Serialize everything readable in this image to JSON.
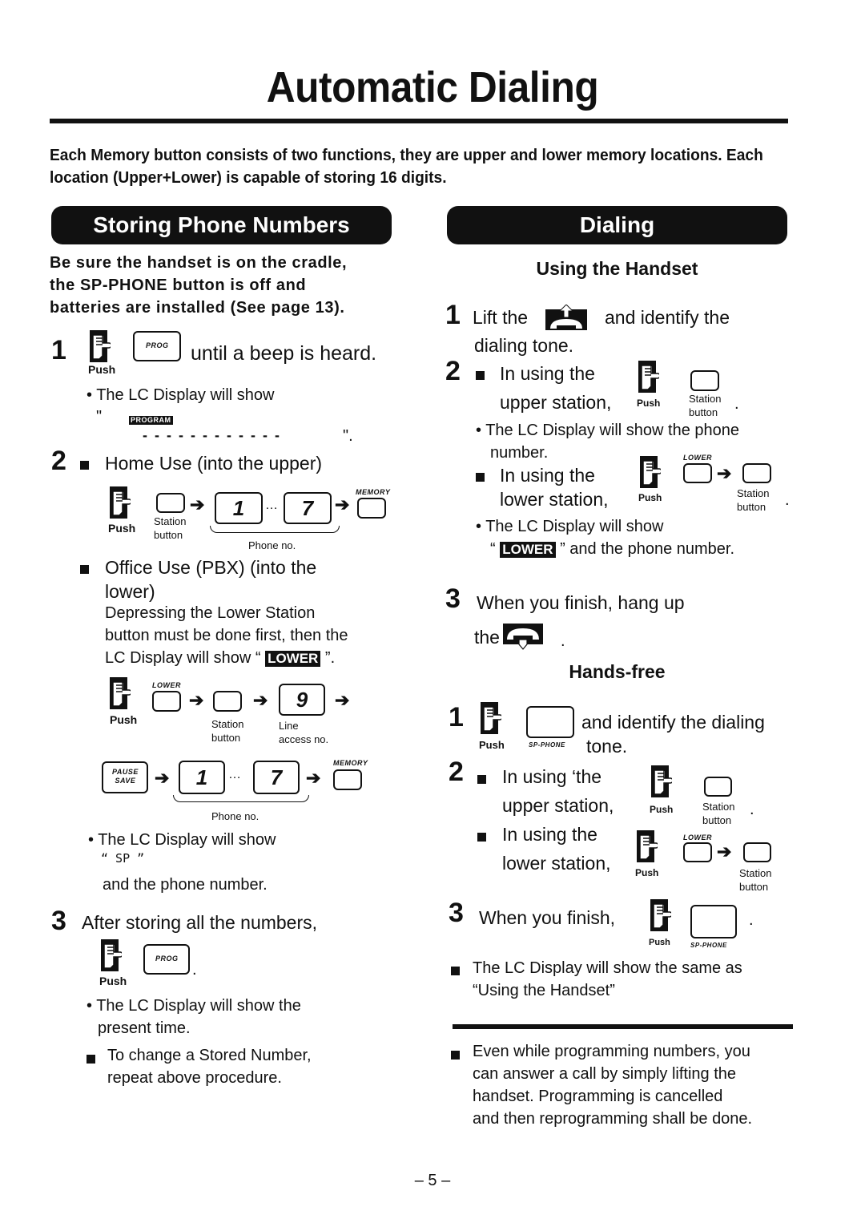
{
  "page": {
    "title": "Automatic Dialing",
    "intro": "Each Memory button consists of two functions, they are upper and lower memory locations. Each location (Upper+Lower) is capable of storing 16 digits.",
    "page_number": "– 5 –"
  },
  "icons": {
    "push_hand": "push-hand-icon",
    "handset_lift": "handset-lift-icon",
    "handset_hangup": "handset-hangup-icon",
    "arrow": "arrow-right-icon",
    "bullet_square": "square-bullet-icon"
  },
  "labels": {
    "push": "Push",
    "station": "Station",
    "button": "button",
    "phone_no": "Phone no.",
    "line": "Line",
    "access_no": "access no.",
    "memory": "MEMORY",
    "lower": "LOWER",
    "prog": "PROG",
    "pause": "PAUSE",
    "save": "SAVE",
    "sp_phone": "SP-PHONE",
    "key_1": "1",
    "key_7": "7",
    "key_9": "9",
    "ellipsis": "…",
    "arrow": "➔",
    "dot": "."
  },
  "storing": {
    "banner": "Storing Phone Numbers",
    "precondition": [
      "Be sure the handset is on the cradle,",
      "the SP-PHONE button is off and",
      "batteries are installed (See page 13)."
    ],
    "step1": {
      "num": "1",
      "text": "until a beep is heard.",
      "bullet": "• The LC Display will show",
      "display_open": "\"",
      "display_badge": "PROGRAM",
      "display_dashes": "- - - - - - - - - - - -",
      "display_close": "\"."
    },
    "step2": {
      "num": "2",
      "home_use": "Home Use (into the upper)",
      "office_use_1": "Office Use (PBX) (into the",
      "office_use_2": "lower)",
      "note": [
        "Depressing the Lower Station",
        "button must be done first, then the"
      ],
      "note_last_pre": "LC Display will show “",
      "note_badge": "LOWER",
      "note_last_post": "”.",
      "bullet": "• The LC Display will show",
      "sp_display": "“ SP ”",
      "after": "and the phone number."
    },
    "step3": {
      "num": "3",
      "text": "After storing all the numbers,",
      "bullet_1": "• The LC Display will show the",
      "bullet_2": "present time.",
      "note_1": "To change a Stored Number,",
      "note_2": "repeat above procedure."
    }
  },
  "dialing": {
    "banner": "Dialing",
    "handset": {
      "heading": "Using the Handset",
      "step1_num": "1",
      "step1_pre": "Lift the",
      "step1_post": "and identify the",
      "step1_line2": "dialing tone.",
      "step2_num": "2",
      "upper_1": "In using the",
      "upper_2": "upper station,",
      "upper_bullet_1": "• The LC Display will show the phone",
      "upper_bullet_2": "number.",
      "lower_1": "In using the",
      "lower_2": "lower station,",
      "lower_bullet_1": "• The LC Display will show",
      "lower_bullet_2_pre": "“",
      "lower_badge": "LOWER",
      "lower_bullet_2_post": "” and the phone number.",
      "step3_num": "3",
      "step3_1": "When you finish, hang up",
      "step3_2": "the"
    },
    "handsfree": {
      "heading": "Hands-free",
      "step1_num": "1",
      "step1_text": "and identify the dialing",
      "step1_text2": "tone.",
      "step2_num": "2",
      "upper_1": "In using ‘the",
      "upper_2": "upper station,",
      "lower_1": "In using the",
      "lower_2": "lower station,",
      "step3_num": "3",
      "step3_text": "When you finish,",
      "note_1": "The LC Display will show the same as",
      "note_2": "“Using the Handset”"
    },
    "footer_note": [
      "Even while programming numbers, you",
      "can answer a call by simply lifting the",
      "handset. Programming is cancelled",
      "and then reprogramming shall be done."
    ]
  }
}
